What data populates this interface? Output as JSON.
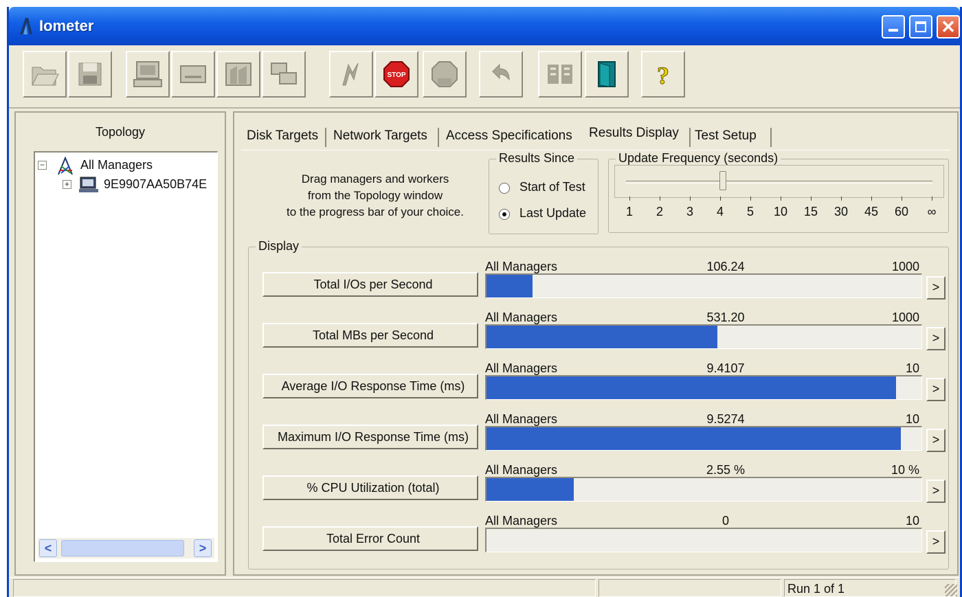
{
  "window": {
    "title": "Iometer",
    "icons": {
      "app": "iometer-app-icon",
      "minimize": "minimize-icon",
      "maximize": "maximize-icon",
      "close": "close-icon"
    }
  },
  "toolbar": {
    "buttons": [
      {
        "name": "open-config",
        "icon": "folder-open-icon"
      },
      {
        "name": "save-config",
        "icon": "floppy-disk-icon"
      },
      {
        "name": "start-disk-worker",
        "icon": "computer-worker-icon"
      },
      {
        "name": "start-network-worker",
        "icon": "network-worker-icon"
      },
      {
        "name": "duplicate-worker",
        "icon": "duplicate-worker-icon"
      },
      {
        "name": "new-manager",
        "icon": "new-manager-icon"
      },
      {
        "name": "start-tests",
        "icon": "green-flag-icon"
      },
      {
        "name": "stop-test",
        "icon": "stop-sign-icon",
        "label": "STOP"
      },
      {
        "name": "stop-all",
        "icon": "stop-all-icon"
      },
      {
        "name": "reset-workers",
        "icon": "undo-arrow-icon"
      },
      {
        "name": "disconnect",
        "icon": "disconnect-icon"
      },
      {
        "name": "exit",
        "icon": "exit-door-icon"
      },
      {
        "name": "about",
        "icon": "question-mark-icon"
      }
    ]
  },
  "topology": {
    "title": "Topology",
    "tree": [
      {
        "label": "All Managers",
        "icon": "network-managers-icon",
        "expander": "−"
      },
      {
        "label": "9E9907AA50B74E",
        "icon": "computer-manager-icon",
        "expander": "+"
      }
    ],
    "scroll_left": "<",
    "scroll_right": ">"
  },
  "tabs": [
    {
      "label": "Disk Targets",
      "active": false
    },
    {
      "label": "Network Targets",
      "active": false
    },
    {
      "label": "Access Specifications",
      "active": false
    },
    {
      "label": "Results Display",
      "active": true
    },
    {
      "label": "Test Setup",
      "active": false
    }
  ],
  "results": {
    "instructions": [
      "Drag managers and workers",
      "from the Topology window",
      "to the progress bar of your choice."
    ],
    "results_since": {
      "label": "Results Since",
      "options": [
        {
          "label": "Start of Test",
          "checked": false
        },
        {
          "label": "Last Update",
          "checked": true
        }
      ]
    },
    "update_frequency": {
      "label": "Update Frequency (seconds)",
      "ticks": [
        "1",
        "2",
        "3",
        "4",
        "5",
        "10",
        "15",
        "30",
        "45",
        "60",
        "∞"
      ],
      "selected": "4"
    },
    "display_label": "Display",
    "metrics": [
      {
        "button": "Total I/Os per Second",
        "source": "All Managers",
        "value": "106.24",
        "max": "1000",
        "fraction": 0.106
      },
      {
        "button": "Total MBs per Second",
        "source": "All Managers",
        "value": "531.20",
        "max": "1000",
        "fraction": 0.531
      },
      {
        "button": "Average I/O Response Time (ms)",
        "source": "All Managers",
        "value": "9.4107",
        "max": "10",
        "fraction": 0.941
      },
      {
        "button": "Maximum I/O Response Time (ms)",
        "source": "All Managers",
        "value": "9.5274",
        "max": "10",
        "fraction": 0.953
      },
      {
        "button": "% CPU Utilization (total)",
        "source": "All Managers",
        "value": "2.55 %",
        "max": "10 %",
        "fraction": 0.2
      },
      {
        "button": "Total Error Count",
        "source": "All Managers",
        "value": "0",
        "max": "10",
        "fraction": 0
      }
    ],
    "arrow_label": ">"
  },
  "status": {
    "run": "Run 1 of 1"
  },
  "colors": {
    "title_bar": "#0a4fd7",
    "progress_fill": "#2f62c9",
    "chrome": "#ece9d8"
  }
}
